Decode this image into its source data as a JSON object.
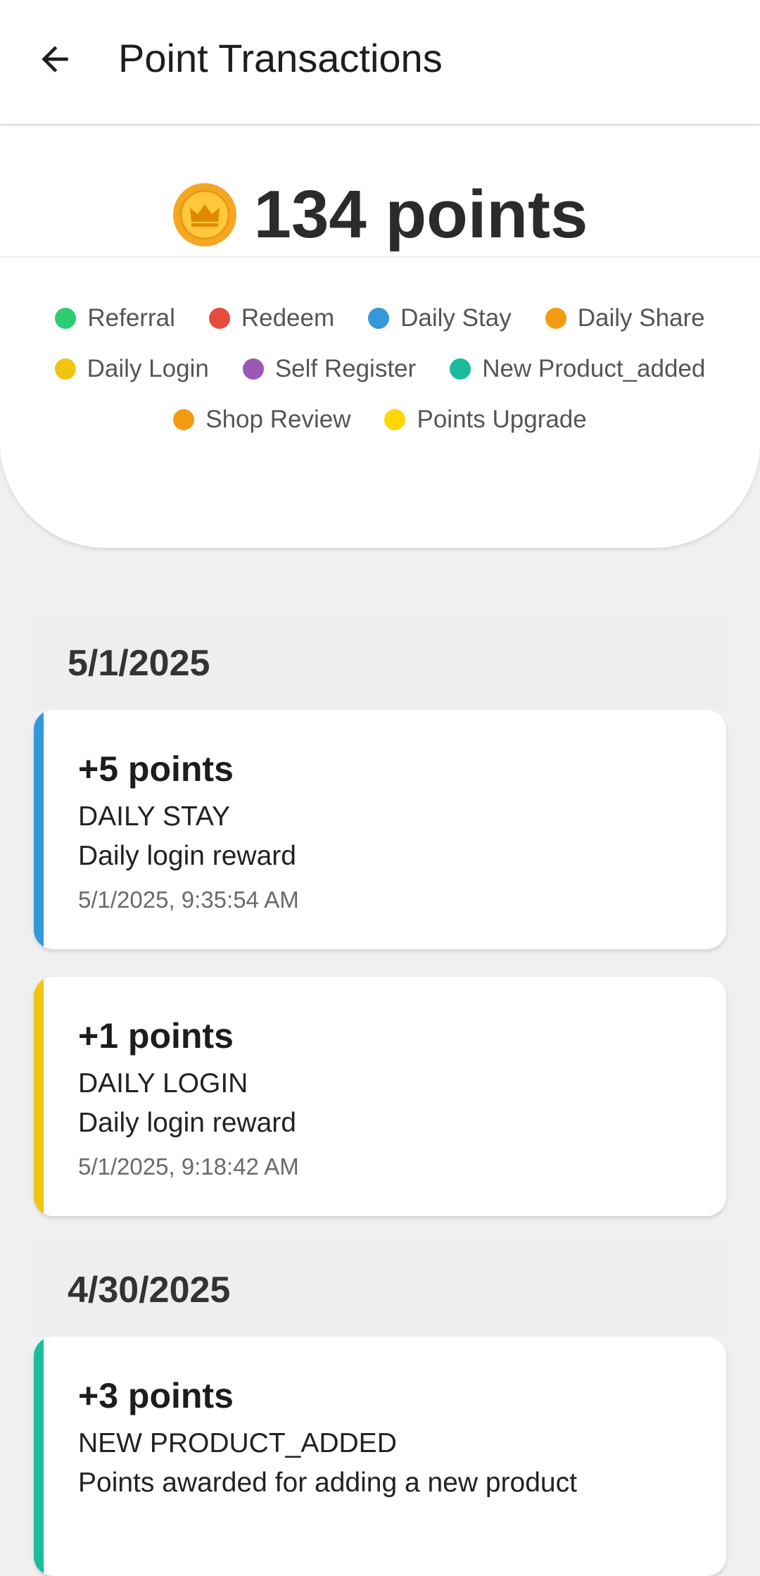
{
  "appbar": {
    "title": "Point Transactions"
  },
  "summary": {
    "points_total": "134 points",
    "coin_color": "#F5A623"
  },
  "legend": [
    {
      "label": "Referral",
      "color": "#2ECC71"
    },
    {
      "label": "Redeem",
      "color": "#E74C3C"
    },
    {
      "label": "Daily Stay",
      "color": "#3498DB"
    },
    {
      "label": "Daily Share",
      "color": "#F39C12"
    },
    {
      "label": "Daily Login",
      "color": "#F1C40F"
    },
    {
      "label": "Self Register",
      "color": "#9B59B6"
    },
    {
      "label": "New Product_added",
      "color": "#1ABC9C"
    },
    {
      "label": "Shop Review",
      "color": "#F39C12"
    },
    {
      "label": "Points Upgrade",
      "color": "#FFD700"
    }
  ],
  "sections": [
    {
      "date": "5/1/2025",
      "transactions": [
        {
          "points": "+5 points",
          "type": "DAILY STAY",
          "description": "Daily login reward",
          "timestamp": "5/1/2025, 9:35:54 AM",
          "color": "#3498DB"
        },
        {
          "points": "+1 points",
          "type": "DAILY LOGIN",
          "description": "Daily login reward",
          "timestamp": "5/1/2025, 9:18:42 AM",
          "color": "#F1C40F"
        }
      ]
    },
    {
      "date": "4/30/2025",
      "transactions": [
        {
          "points": "+3 points",
          "type": "NEW PRODUCT_ADDED",
          "description": "Points awarded for adding a new product",
          "timestamp": "",
          "color": "#1ABC9C"
        }
      ]
    }
  ]
}
